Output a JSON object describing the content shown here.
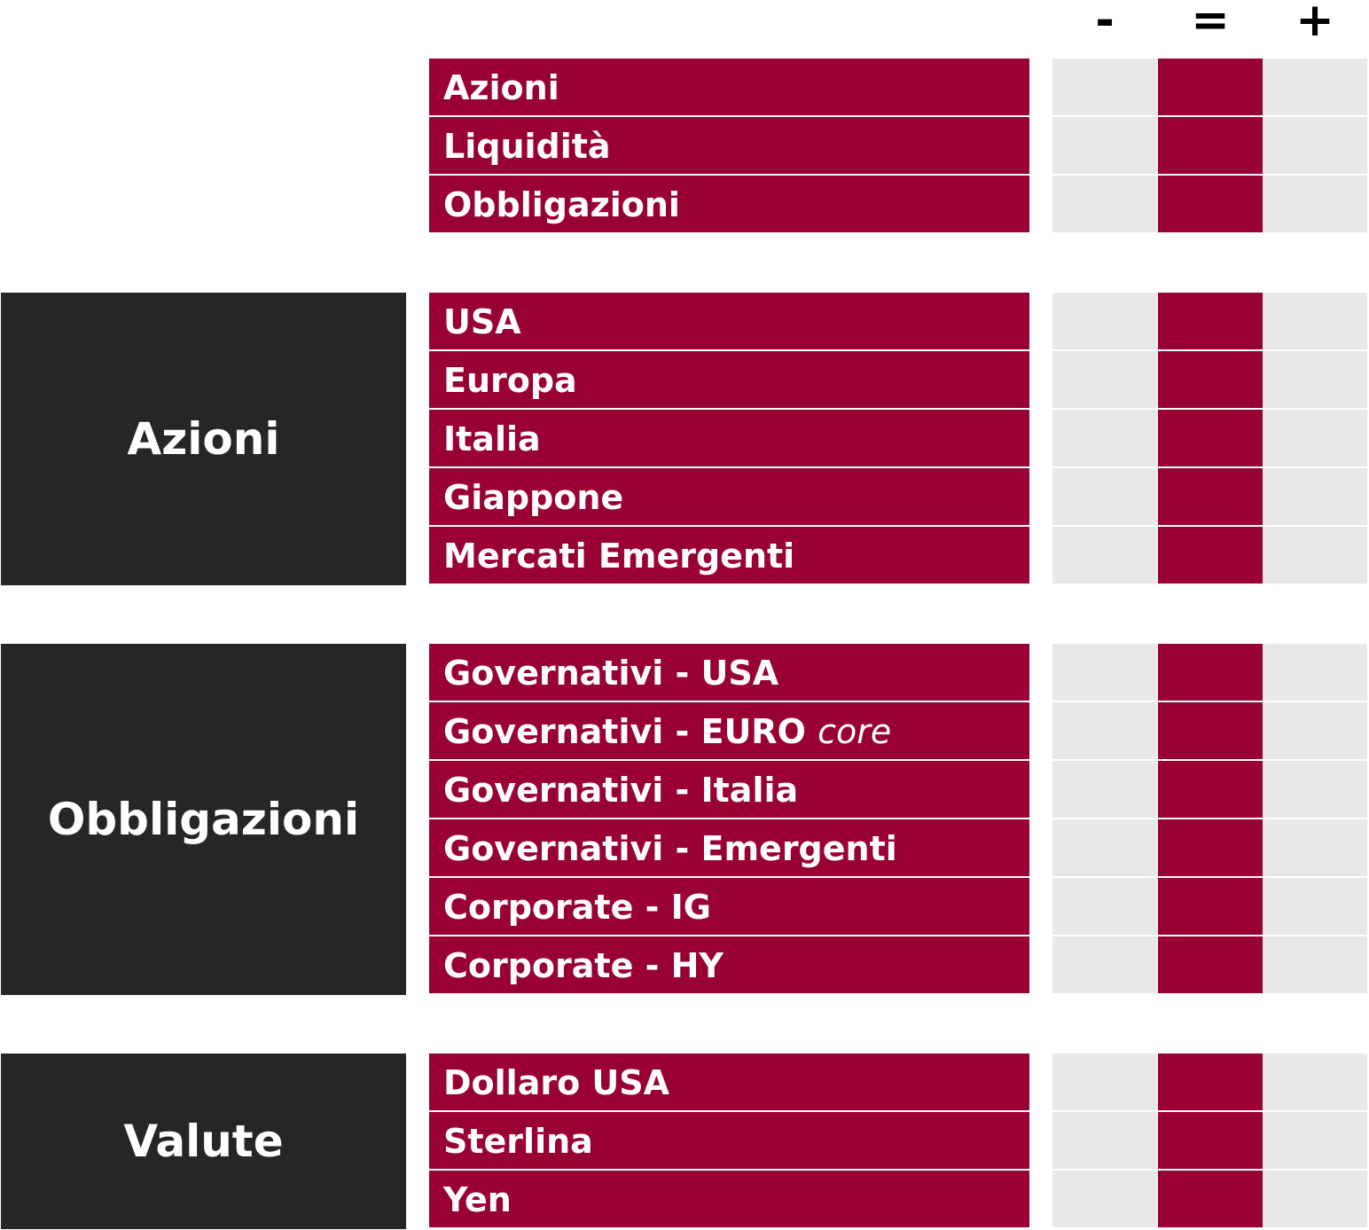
{
  "headers": {
    "minus": "-",
    "equal": "=",
    "plus": "+"
  },
  "colors": {
    "accent": "#990033",
    "dark": "#262626",
    "empty": "#e8e8e8"
  },
  "rows": {
    "r0": "Azioni",
    "r1": "Liquidità",
    "r2": "Obbligazioni",
    "r3": "USA",
    "r4": "Europa",
    "r5": "Italia",
    "r6": "Giappone",
    "r7": "Mercati Emergenti",
    "r8_main": "Governativi - USA",
    "r9_main": "Governativi - EURO",
    "r9_em": "core",
    "r10": "Governativi - Italia",
    "r11": "Governativi - Emergenti",
    "r12": "Corporate - IG",
    "r13": "Corporate - HY",
    "r14": "Dollaro USA",
    "r15": "Sterlina",
    "r16": "Yen"
  },
  "groups": {
    "azioni": "Azioni",
    "obbligazioni": "Obbligazioni",
    "valute": "Valute"
  },
  "views": [
    "=",
    "=",
    "=",
    "=",
    "=",
    "=",
    "=",
    "=",
    "=",
    "=",
    "=",
    "=",
    "=",
    "=",
    "=",
    "=",
    "="
  ]
}
